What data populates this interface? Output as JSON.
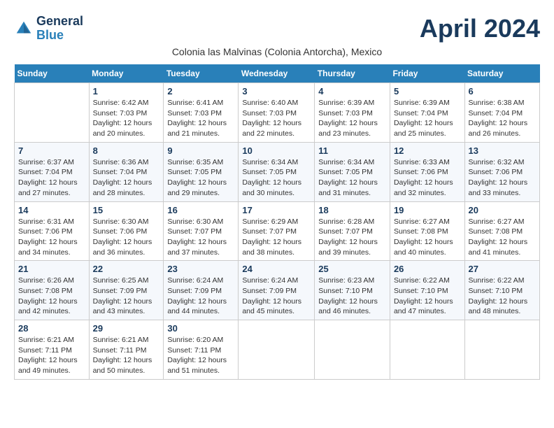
{
  "header": {
    "logo_line1": "General",
    "logo_line2": "Blue",
    "month_title": "April 2024",
    "subtitle": "Colonia las Malvinas (Colonia Antorcha), Mexico"
  },
  "days_of_week": [
    "Sunday",
    "Monday",
    "Tuesday",
    "Wednesday",
    "Thursday",
    "Friday",
    "Saturday"
  ],
  "weeks": [
    [
      {
        "day": "",
        "sunrise": "",
        "sunset": "",
        "daylight": ""
      },
      {
        "day": "1",
        "sunrise": "Sunrise: 6:42 AM",
        "sunset": "Sunset: 7:03 PM",
        "daylight": "Daylight: 12 hours and 20 minutes."
      },
      {
        "day": "2",
        "sunrise": "Sunrise: 6:41 AM",
        "sunset": "Sunset: 7:03 PM",
        "daylight": "Daylight: 12 hours and 21 minutes."
      },
      {
        "day": "3",
        "sunrise": "Sunrise: 6:40 AM",
        "sunset": "Sunset: 7:03 PM",
        "daylight": "Daylight: 12 hours and 22 minutes."
      },
      {
        "day": "4",
        "sunrise": "Sunrise: 6:39 AM",
        "sunset": "Sunset: 7:03 PM",
        "daylight": "Daylight: 12 hours and 23 minutes."
      },
      {
        "day": "5",
        "sunrise": "Sunrise: 6:39 AM",
        "sunset": "Sunset: 7:04 PM",
        "daylight": "Daylight: 12 hours and 25 minutes."
      },
      {
        "day": "6",
        "sunrise": "Sunrise: 6:38 AM",
        "sunset": "Sunset: 7:04 PM",
        "daylight": "Daylight: 12 hours and 26 minutes."
      }
    ],
    [
      {
        "day": "7",
        "sunrise": "Sunrise: 6:37 AM",
        "sunset": "Sunset: 7:04 PM",
        "daylight": "Daylight: 12 hours and 27 minutes."
      },
      {
        "day": "8",
        "sunrise": "Sunrise: 6:36 AM",
        "sunset": "Sunset: 7:04 PM",
        "daylight": "Daylight: 12 hours and 28 minutes."
      },
      {
        "day": "9",
        "sunrise": "Sunrise: 6:35 AM",
        "sunset": "Sunset: 7:05 PM",
        "daylight": "Daylight: 12 hours and 29 minutes."
      },
      {
        "day": "10",
        "sunrise": "Sunrise: 6:34 AM",
        "sunset": "Sunset: 7:05 PM",
        "daylight": "Daylight: 12 hours and 30 minutes."
      },
      {
        "day": "11",
        "sunrise": "Sunrise: 6:34 AM",
        "sunset": "Sunset: 7:05 PM",
        "daylight": "Daylight: 12 hours and 31 minutes."
      },
      {
        "day": "12",
        "sunrise": "Sunrise: 6:33 AM",
        "sunset": "Sunset: 7:06 PM",
        "daylight": "Daylight: 12 hours and 32 minutes."
      },
      {
        "day": "13",
        "sunrise": "Sunrise: 6:32 AM",
        "sunset": "Sunset: 7:06 PM",
        "daylight": "Daylight: 12 hours and 33 minutes."
      }
    ],
    [
      {
        "day": "14",
        "sunrise": "Sunrise: 6:31 AM",
        "sunset": "Sunset: 7:06 PM",
        "daylight": "Daylight: 12 hours and 34 minutes."
      },
      {
        "day": "15",
        "sunrise": "Sunrise: 6:30 AM",
        "sunset": "Sunset: 7:06 PM",
        "daylight": "Daylight: 12 hours and 36 minutes."
      },
      {
        "day": "16",
        "sunrise": "Sunrise: 6:30 AM",
        "sunset": "Sunset: 7:07 PM",
        "daylight": "Daylight: 12 hours and 37 minutes."
      },
      {
        "day": "17",
        "sunrise": "Sunrise: 6:29 AM",
        "sunset": "Sunset: 7:07 PM",
        "daylight": "Daylight: 12 hours and 38 minutes."
      },
      {
        "day": "18",
        "sunrise": "Sunrise: 6:28 AM",
        "sunset": "Sunset: 7:07 PM",
        "daylight": "Daylight: 12 hours and 39 minutes."
      },
      {
        "day": "19",
        "sunrise": "Sunrise: 6:27 AM",
        "sunset": "Sunset: 7:08 PM",
        "daylight": "Daylight: 12 hours and 40 minutes."
      },
      {
        "day": "20",
        "sunrise": "Sunrise: 6:27 AM",
        "sunset": "Sunset: 7:08 PM",
        "daylight": "Daylight: 12 hours and 41 minutes."
      }
    ],
    [
      {
        "day": "21",
        "sunrise": "Sunrise: 6:26 AM",
        "sunset": "Sunset: 7:08 PM",
        "daylight": "Daylight: 12 hours and 42 minutes."
      },
      {
        "day": "22",
        "sunrise": "Sunrise: 6:25 AM",
        "sunset": "Sunset: 7:09 PM",
        "daylight": "Daylight: 12 hours and 43 minutes."
      },
      {
        "day": "23",
        "sunrise": "Sunrise: 6:24 AM",
        "sunset": "Sunset: 7:09 PM",
        "daylight": "Daylight: 12 hours and 44 minutes."
      },
      {
        "day": "24",
        "sunrise": "Sunrise: 6:24 AM",
        "sunset": "Sunset: 7:09 PM",
        "daylight": "Daylight: 12 hours and 45 minutes."
      },
      {
        "day": "25",
        "sunrise": "Sunrise: 6:23 AM",
        "sunset": "Sunset: 7:10 PM",
        "daylight": "Daylight: 12 hours and 46 minutes."
      },
      {
        "day": "26",
        "sunrise": "Sunrise: 6:22 AM",
        "sunset": "Sunset: 7:10 PM",
        "daylight": "Daylight: 12 hours and 47 minutes."
      },
      {
        "day": "27",
        "sunrise": "Sunrise: 6:22 AM",
        "sunset": "Sunset: 7:10 PM",
        "daylight": "Daylight: 12 hours and 48 minutes."
      }
    ],
    [
      {
        "day": "28",
        "sunrise": "Sunrise: 6:21 AM",
        "sunset": "Sunset: 7:11 PM",
        "daylight": "Daylight: 12 hours and 49 minutes."
      },
      {
        "day": "29",
        "sunrise": "Sunrise: 6:21 AM",
        "sunset": "Sunset: 7:11 PM",
        "daylight": "Daylight: 12 hours and 50 minutes."
      },
      {
        "day": "30",
        "sunrise": "Sunrise: 6:20 AM",
        "sunset": "Sunset: 7:11 PM",
        "daylight": "Daylight: 12 hours and 51 minutes."
      },
      {
        "day": "",
        "sunrise": "",
        "sunset": "",
        "daylight": ""
      },
      {
        "day": "",
        "sunrise": "",
        "sunset": "",
        "daylight": ""
      },
      {
        "day": "",
        "sunrise": "",
        "sunset": "",
        "daylight": ""
      },
      {
        "day": "",
        "sunrise": "",
        "sunset": "",
        "daylight": ""
      }
    ]
  ]
}
